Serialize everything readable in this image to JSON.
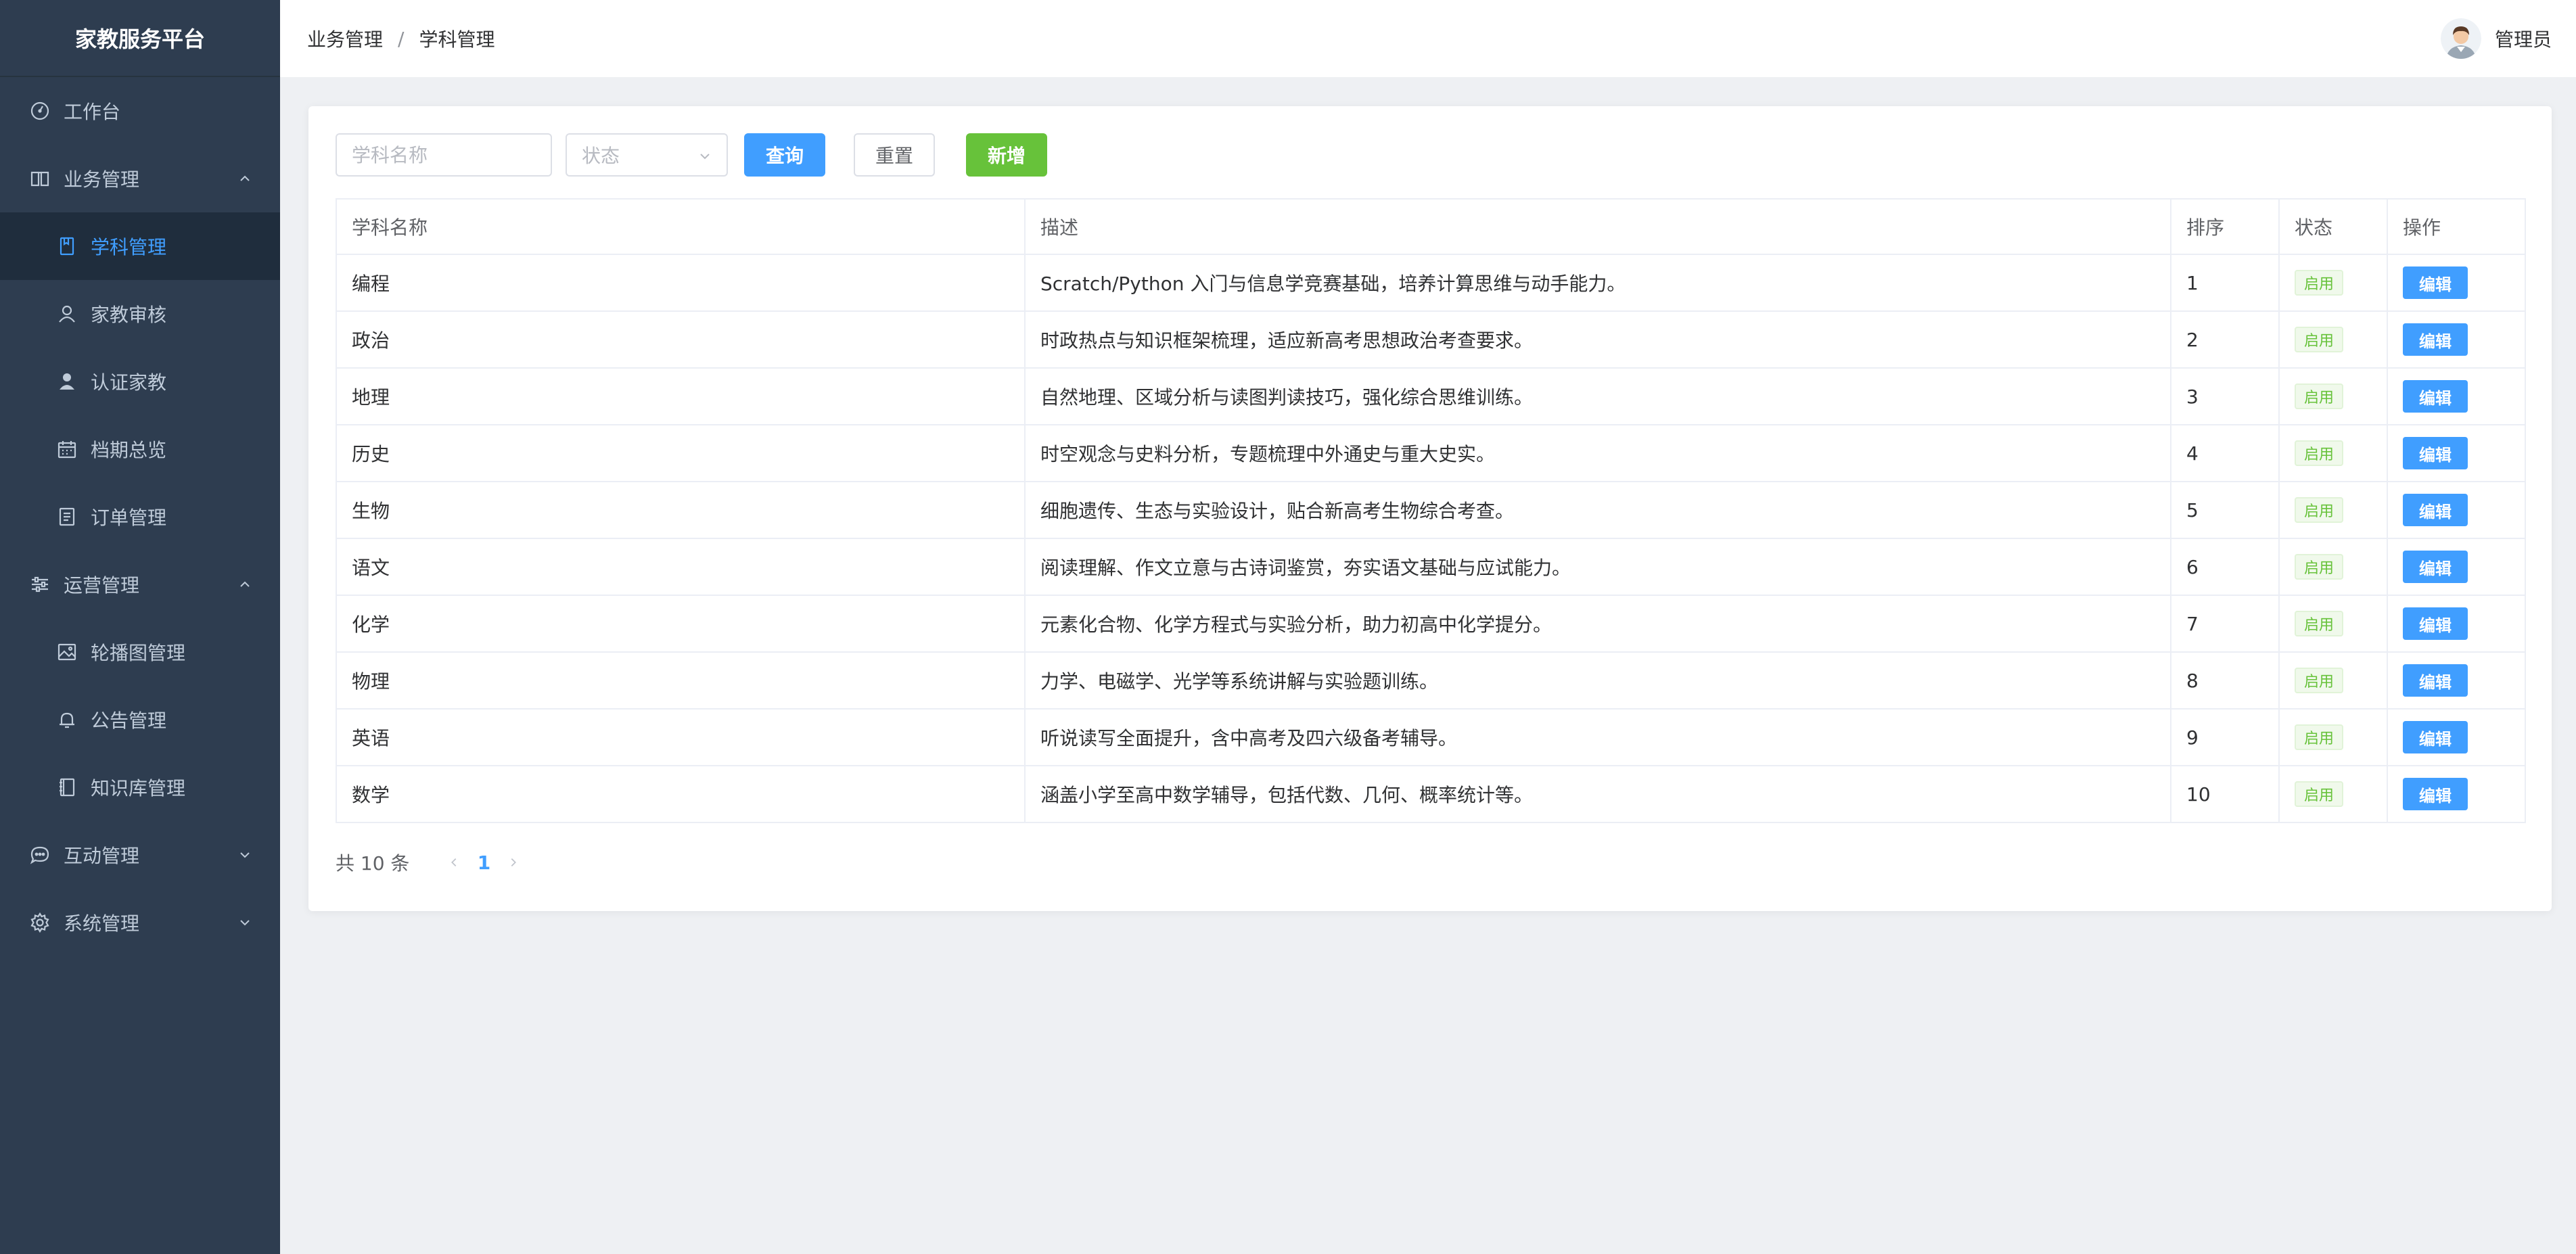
{
  "sidebar": {
    "brand": "家教服务平台",
    "menu": {
      "workbench": "工作台",
      "business": "业务管理",
      "subject": "学科管理",
      "tutor_review": "家教审核",
      "certified_tutor": "认证家教",
      "schedule": "档期总览",
      "orders": "订单管理",
      "operations": "运营管理",
      "banner": "轮播图管理",
      "notice": "公告管理",
      "knowledge": "知识库管理",
      "interaction": "互动管理",
      "system": "系统管理"
    }
  },
  "header": {
    "breadcrumb": [
      "业务管理",
      "学科管理"
    ],
    "separator": "/",
    "user": "管理员"
  },
  "filters": {
    "name_placeholder": "学科名称",
    "status_placeholder": "状态",
    "search_label": "查询",
    "reset_label": "重置",
    "add_label": "新增"
  },
  "table": {
    "columns": [
      "学科名称",
      "描述",
      "排序",
      "状态",
      "操作"
    ],
    "rows": [
      {
        "name": "编程",
        "desc": "Scratch/Python 入门与信息学竞赛基础，培养计算思维与动手能力。",
        "order": "1",
        "status": "启用",
        "action": "编辑"
      },
      {
        "name": "政治",
        "desc": "时政热点与知识框架梳理，适应新高考思想政治考查要求。",
        "order": "2",
        "status": "启用",
        "action": "编辑"
      },
      {
        "name": "地理",
        "desc": "自然地理、区域分析与读图判读技巧，强化综合思维训练。",
        "order": "3",
        "status": "启用",
        "action": "编辑"
      },
      {
        "name": "历史",
        "desc": "时空观念与史料分析，专题梳理中外通史与重大史实。",
        "order": "4",
        "status": "启用",
        "action": "编辑"
      },
      {
        "name": "生物",
        "desc": "细胞遗传、生态与实验设计，贴合新高考生物综合考查。",
        "order": "5",
        "status": "启用",
        "action": "编辑"
      },
      {
        "name": "语文",
        "desc": "阅读理解、作文立意与古诗词鉴赏，夯实语文基础与应试能力。",
        "order": "6",
        "status": "启用",
        "action": "编辑"
      },
      {
        "name": "化学",
        "desc": "元素化合物、化学方程式与实验分析，助力初高中化学提分。",
        "order": "7",
        "status": "启用",
        "action": "编辑"
      },
      {
        "name": "物理",
        "desc": "力学、电磁学、光学等系统讲解与实验题训练。",
        "order": "8",
        "status": "启用",
        "action": "编辑"
      },
      {
        "name": "英语",
        "desc": "听说读写全面提升，含中高考及四六级备考辅导。",
        "order": "9",
        "status": "启用",
        "action": "编辑"
      },
      {
        "name": "数学",
        "desc": "涵盖小学至高中数学辅导，包括代数、几何、概率统计等。",
        "order": "10",
        "status": "启用",
        "action": "编辑"
      }
    ]
  },
  "pagination": {
    "total": "共 10 条",
    "current": "1"
  },
  "colors": {
    "sidebar_bg": "#2e3d50",
    "accent": "#409eff",
    "success": "#67c23a"
  }
}
